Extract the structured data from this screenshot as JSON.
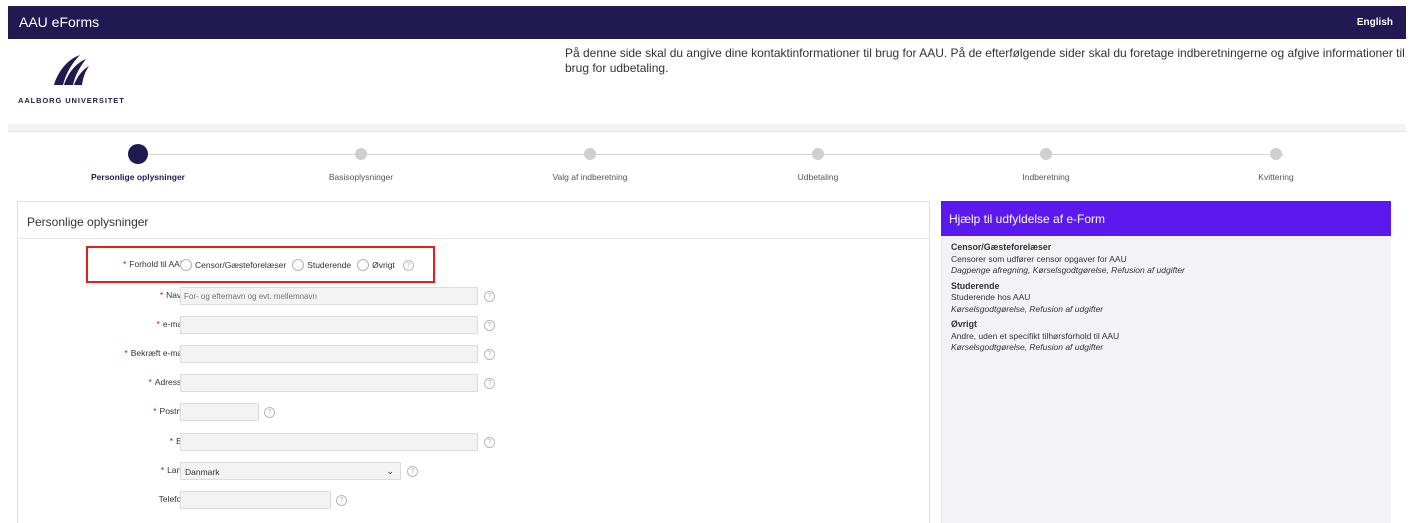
{
  "topbar": {
    "title": "AAU eForms",
    "language": "English"
  },
  "header": {
    "logo_text": "AALBORG UNIVERSITET",
    "intro": "På denne side skal du angive dine kontaktinformationer til brug for AAU. På de efterfølgende sider skal du foretage indberetningerne og afgive informationer til brug for udbetaling."
  },
  "stepper": {
    "steps": [
      {
        "label": "Personlige oplysninger",
        "active": true
      },
      {
        "label": "Basisoplysninger",
        "active": false
      },
      {
        "label": "Valg af indberetning",
        "active": false
      },
      {
        "label": "Udbetaling",
        "active": false
      },
      {
        "label": "Indberetning",
        "active": false
      },
      {
        "label": "Kvittering",
        "active": false
      }
    ]
  },
  "form": {
    "title": "Personlige oplysninger",
    "relation": {
      "label": "Forhold til AAU",
      "required_mark": "*",
      "options": [
        "Censor/Gæsteforelæser",
        "Studerende",
        "Øvrigt"
      ]
    },
    "fields": {
      "name": {
        "label": "Navn",
        "placeholder": "For- og efternavn og evt. mellemnavn"
      },
      "email": {
        "label": "e-mail",
        "placeholder": ""
      },
      "confirm_email": {
        "label": "Bekræft e-mail",
        "placeholder": ""
      },
      "address": {
        "label": "Adresse",
        "placeholder": ""
      },
      "postal": {
        "label": "Postnr.",
        "placeholder": ""
      },
      "city": {
        "label": "By",
        "placeholder": ""
      },
      "country": {
        "label": "Land",
        "value": "Danmark"
      },
      "phone": {
        "label": "Telefon",
        "placeholder": ""
      }
    },
    "help_glyph": "?",
    "required_mark": "*"
  },
  "help_panel": {
    "title": "Hjælp til udfyldelse af e-Form",
    "items": [
      {
        "title": "Censor/Gæsteforelæser",
        "desc": "Censorer som udfører censor opgaver for AAU",
        "examples": "Dagpenge afregning, Kørselsgodtgørelse, Refusion af udgifter"
      },
      {
        "title": "Studerende",
        "desc": "Studerende hos AAU",
        "examples": "Kørselsgodtgørelse, Refusion af udgifter"
      },
      {
        "title": "Øvrigt",
        "desc": "Andre, uden et specifikt tilhørsforhold til AAU",
        "examples": "Kørselsgodtgørelse, Refusion af udgifter"
      }
    ]
  },
  "colors": {
    "brand": "#211a52",
    "accent": "#5b19f0",
    "required": "#d0021b",
    "highlight": "#e11f1f"
  }
}
